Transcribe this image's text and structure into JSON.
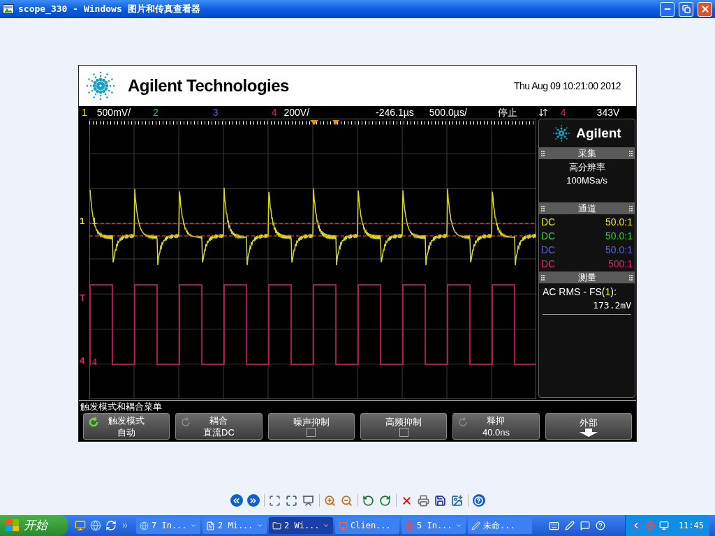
{
  "window": {
    "title": "scope_330 - Windows 图片和传真查看器"
  },
  "scope": {
    "brand": "Agilent Technologies",
    "datetime": "Thu Aug 09 10:21:00 2012",
    "status_bar": [
      {
        "text": "1",
        "color": "#e8e800"
      },
      {
        "text": "500mV/"
      },
      {
        "text": "2",
        "color": "#33cc33"
      },
      {
        "text": "3",
        "color": "#5566dd"
      },
      {
        "text": "4",
        "color": "#e0206a"
      },
      {
        "text": "200V/"
      },
      {
        "text": "-246.1µs"
      },
      {
        "text": "500.0µs/"
      },
      {
        "text": "停止"
      },
      {
        "text": "4",
        "color": "#e0206a"
      },
      {
        "text": "343V"
      }
    ],
    "markers": [
      {
        "label": "1",
        "color": "#e8e800"
      },
      {
        "label": "T",
        "color": "#e0206a"
      },
      {
        "label": "4",
        "color": "#e0206a"
      }
    ],
    "trace_labels": [
      {
        "label": "1",
        "color": "#e8e800"
      },
      {
        "label": "4",
        "color": "#e0206a"
      }
    ],
    "side_panel": {
      "brand": "Agilent",
      "acquisition": {
        "title": "采集",
        "mode": "高分辨率",
        "rate": "100MSa/s"
      },
      "channels": {
        "title": "通道",
        "rows": [
          {
            "coupling": "DC",
            "probe": "50.0:1",
            "color": "#e8e800"
          },
          {
            "coupling": "DC",
            "probe": "50.0:1",
            "color": "#33cc33"
          },
          {
            "coupling": "DC",
            "probe": "50.0:1",
            "color": "#5566dd"
          },
          {
            "coupling": "DC",
            "probe": "500:1",
            "color": "#e0206a"
          }
        ]
      },
      "measure": {
        "title": "测量",
        "label_parts": [
          "AC RMS - FS(",
          "1",
          "):"
        ],
        "value": "173.2mV"
      }
    },
    "menu_title": "触发模式和耦合菜单",
    "softkeys": [
      {
        "kind": "value",
        "label": "触发模式",
        "value": "自动",
        "knob_active": true
      },
      {
        "kind": "value",
        "label": "耦合",
        "value": "直流DC",
        "knob_active": false
      },
      {
        "kind": "checkbox",
        "label": "噪声抑制",
        "checked": false
      },
      {
        "kind": "checkbox",
        "label": "高频抑制",
        "checked": false
      },
      {
        "kind": "value",
        "label": "释抑",
        "value": "40.0ns",
        "knob_active": false
      },
      {
        "kind": "submenu",
        "label": "外部"
      }
    ]
  },
  "taskbar": {
    "start": "开始",
    "tasks": [
      {
        "label": "7 In...",
        "selected": false,
        "dropdown": true
      },
      {
        "label": "2 Mi...",
        "selected": false,
        "dropdown": true
      },
      {
        "label": "2 Wi...",
        "selected": true,
        "dropdown": true
      },
      {
        "label": "Clien...",
        "selected": false,
        "dropdown": false
      },
      {
        "label": "5 In...",
        "selected": false,
        "dropdown": true
      },
      {
        "label": "未命...",
        "selected": false,
        "dropdown": false
      }
    ],
    "clock": "11:45"
  }
}
